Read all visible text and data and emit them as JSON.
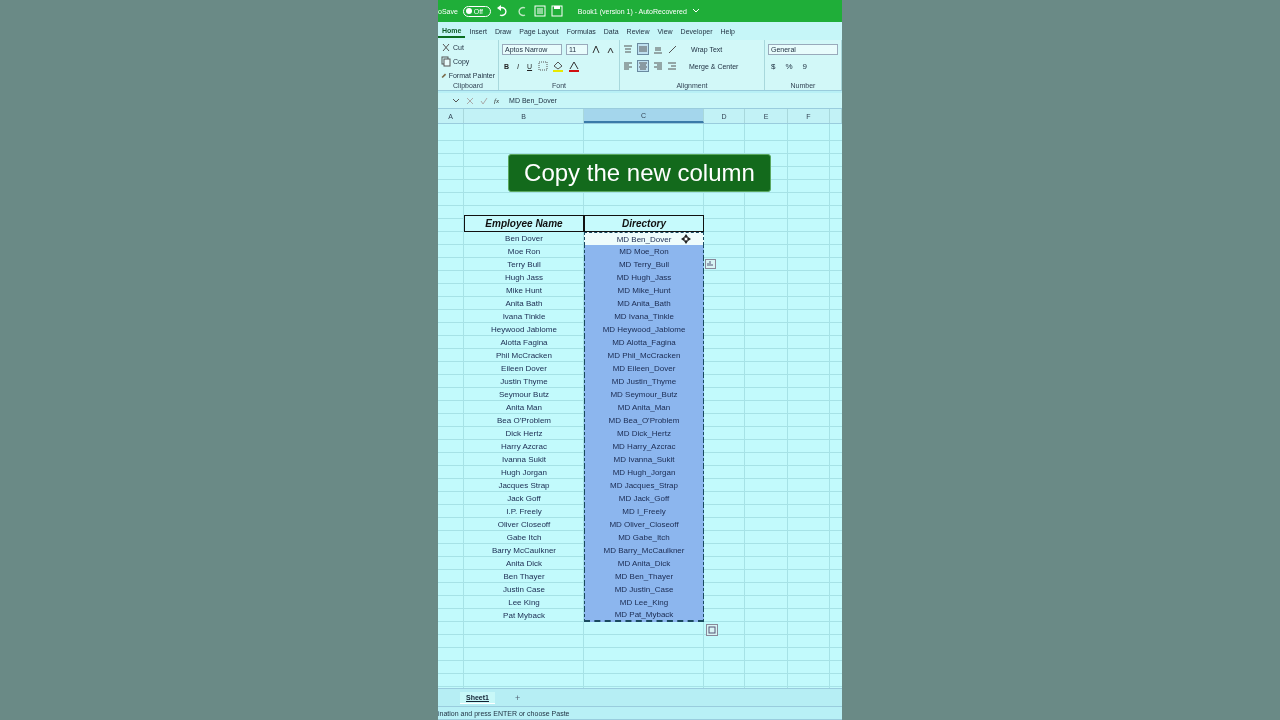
{
  "title_bar": {
    "autosave_label": "oSave",
    "autosave_toggle": {
      "label": "Off",
      "on": false
    },
    "title": "Book1 (version 1) - AutoRecovered"
  },
  "tabs": [
    {
      "label": "Home",
      "selected": true
    },
    {
      "label": "Insert",
      "selected": false
    },
    {
      "label": "Draw",
      "selected": false
    },
    {
      "label": "Page Layout",
      "selected": false
    },
    {
      "label": "Formulas",
      "selected": false
    },
    {
      "label": "Data",
      "selected": false
    },
    {
      "label": "Review",
      "selected": false
    },
    {
      "label": "View",
      "selected": false
    },
    {
      "label": "Developer",
      "selected": false
    },
    {
      "label": "Help",
      "selected": false
    }
  ],
  "ribbon": {
    "clipboard": {
      "label": "Clipboard",
      "buttons": [
        "Cut",
        "Copy",
        "Format Painter"
      ]
    },
    "font": {
      "label": "Font",
      "font_name": "Aptos Narrow",
      "font_size": "11",
      "bold": "B",
      "italic": "I",
      "underline": "U"
    },
    "alignment": {
      "label": "Alignment",
      "wrap_text": "Wrap Text",
      "merge_center": "Merge & Center"
    },
    "number": {
      "label": "Number",
      "format": "General",
      "currency": "$",
      "percent": "%",
      "comma": "9"
    }
  },
  "formula_bar": {
    "fx": "fx",
    "value": "MD Ben_Dover"
  },
  "columns": [
    {
      "label": "A",
      "selected": false
    },
    {
      "label": "B",
      "selected": false
    },
    {
      "label": "C",
      "selected": true
    },
    {
      "label": "D",
      "selected": false
    },
    {
      "label": "E",
      "selected": false
    },
    {
      "label": "F",
      "selected": false
    }
  ],
  "banner": "Copy the new column",
  "table": {
    "headers": [
      "Employee Name",
      "Directory"
    ],
    "rows": [
      {
        "name": "Ben Dover",
        "directory": "MD Ben_Dover",
        "selected": true,
        "active": true
      },
      {
        "name": "Moe Ron",
        "directory": "MD Moe_Ron",
        "selected": true,
        "active": false
      },
      {
        "name": "Terry Bull",
        "directory": "MD Terry_Bull",
        "selected": true,
        "active": false
      },
      {
        "name": "Hugh Jass",
        "directory": "MD Hugh_Jass",
        "selected": true,
        "active": false
      },
      {
        "name": "Mike Hunt",
        "directory": "MD Mike_Hunt",
        "selected": true,
        "active": false
      },
      {
        "name": "Anita Bath",
        "directory": "MD Anita_Bath",
        "selected": true,
        "active": false
      },
      {
        "name": "Ivana Tinkle",
        "directory": "MD Ivana_Tinkle",
        "selected": true,
        "active": false
      },
      {
        "name": "Heywood Jablome",
        "directory": "MD Heywood_Jablome",
        "selected": true,
        "active": false
      },
      {
        "name": "Alotta Fagina",
        "directory": "MD Alotta_Fagina",
        "selected": true,
        "active": false
      },
      {
        "name": "Phil McCracken",
        "directory": "MD Phil_McCracken",
        "selected": true,
        "active": false
      },
      {
        "name": "Eileen Dover",
        "directory": "MD Eileen_Dover",
        "selected": true,
        "active": false
      },
      {
        "name": "Justin Thyme",
        "directory": "MD Justin_Thyme",
        "selected": true,
        "active": false
      },
      {
        "name": "Seymour Butz",
        "directory": "MD Seymour_Butz",
        "selected": true,
        "active": false
      },
      {
        "name": "Anita Man",
        "directory": "MD Anita_Man",
        "selected": true,
        "active": false
      },
      {
        "name": "Bea O'Problem",
        "directory": "MD Bea_O'Problem",
        "selected": true,
        "active": false
      },
      {
        "name": "Dick Hertz",
        "directory": "MD Dick_Hertz",
        "selected": true,
        "active": false
      },
      {
        "name": "Harry Azcrac",
        "directory": "MD Harry_Azcrac",
        "selected": true,
        "active": false
      },
      {
        "name": "Ivanna Sukit",
        "directory": "MD Ivanna_Sukit",
        "selected": true,
        "active": false
      },
      {
        "name": "Hugh Jorgan",
        "directory": "MD Hugh_Jorgan",
        "selected": true,
        "active": false
      },
      {
        "name": "Jacques Strap",
        "directory": "MD Jacques_Strap",
        "selected": true,
        "active": false
      },
      {
        "name": "Jack Goff",
        "directory": "MD Jack_Goff",
        "selected": true,
        "active": false
      },
      {
        "name": "I.P. Freely",
        "directory": "MD I_Freely",
        "selected": true,
        "active": false
      },
      {
        "name": "Oliver Closeoff",
        "directory": "MD Oliver_Closeoff",
        "selected": true,
        "active": false
      },
      {
        "name": "Gabe Itch",
        "directory": "MD Gabe_Itch",
        "selected": true,
        "active": false
      },
      {
        "name": "Barry McCaulkner",
        "directory": "MD Barry_McCaulkner",
        "selected": true,
        "active": false
      },
      {
        "name": "Anita Dick",
        "directory": "MD Anita_Dick",
        "selected": true,
        "active": false
      },
      {
        "name": "Ben Thayer",
        "directory": "MD Ben_Thayer",
        "selected": true,
        "active": false
      },
      {
        "name": "Justin Case",
        "directory": "MD Justin_Case",
        "selected": true,
        "active": false
      },
      {
        "name": "Lee King",
        "directory": "MD Lee_King",
        "selected": true,
        "active": false
      },
      {
        "name": "Pat Myback",
        "directory": "MD Pat_Myback",
        "selected": true,
        "active": false
      }
    ]
  },
  "sheet_tabs": [
    {
      "label": "Sheet1",
      "selected": true
    }
  ],
  "add_sheet": "+",
  "status_bar": "ination and press ENTER or choose Paste"
}
